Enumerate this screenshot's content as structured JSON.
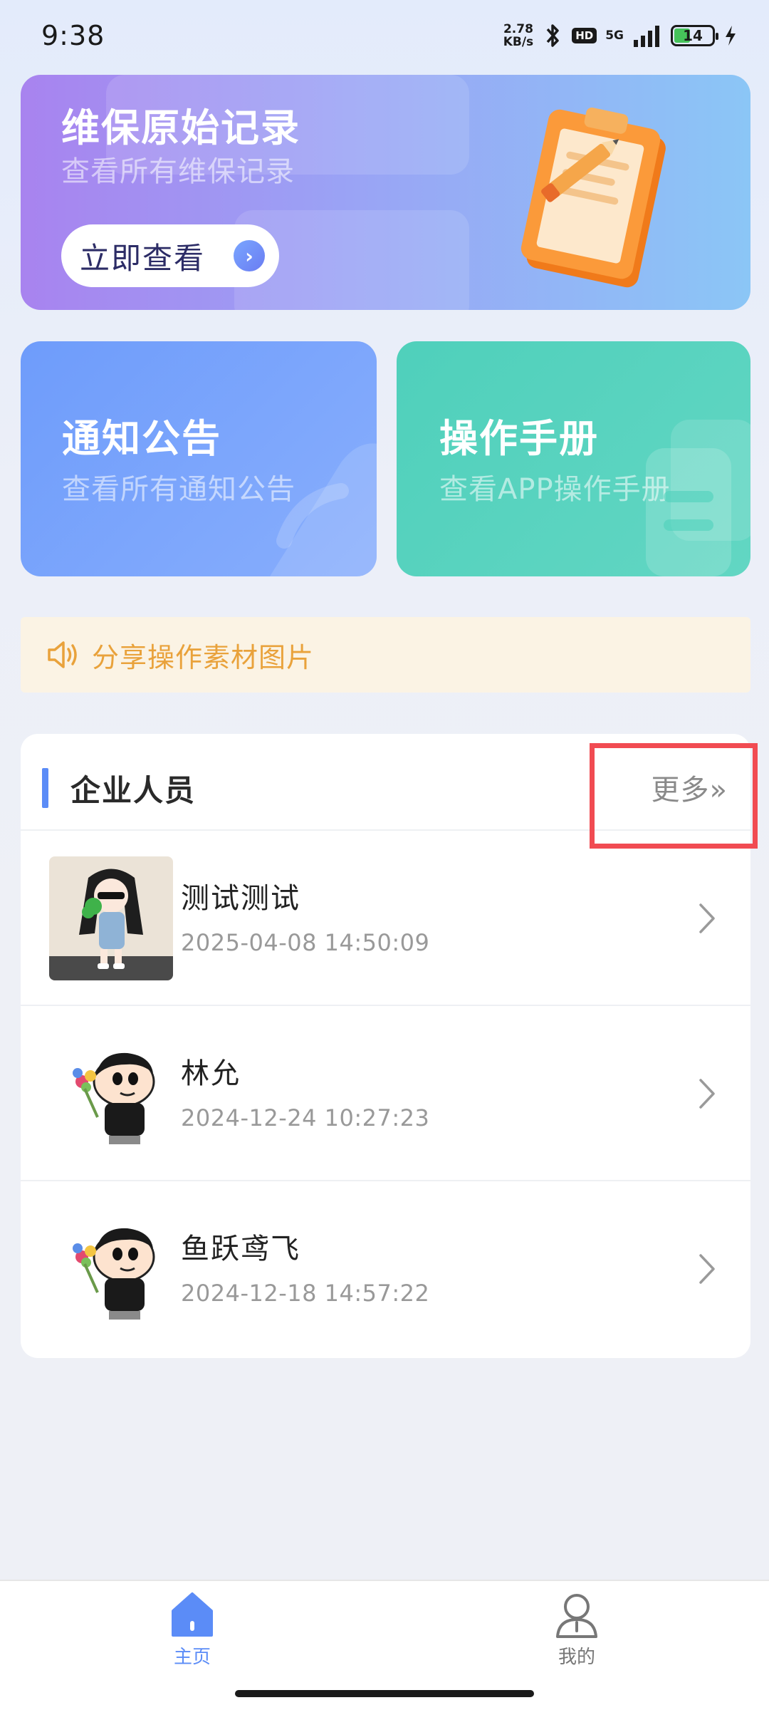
{
  "status_bar": {
    "time": "9:38",
    "net_speed_value": "2.78",
    "net_speed_unit": "KB/s",
    "hd_label": "HD",
    "signal_label": "5G",
    "battery_level": "14",
    "icons": [
      "bluetooth-icon",
      "hd-icon",
      "signal-icon",
      "battery-icon",
      "charging-icon"
    ]
  },
  "maintenance_card": {
    "title": "维保原始记录",
    "subtitle": "查看所有维保记录",
    "button_label": "立即查看",
    "icon": "clipboard-icon"
  },
  "notice_card": {
    "title": "通知公告",
    "subtitle": "查看所有通知公告",
    "icon": "megaphone-icon"
  },
  "manual_card": {
    "title": "操作手册",
    "subtitle": "查看APP操作手册",
    "icon": "document-icon"
  },
  "share_banner": {
    "text": "分享操作素材图片",
    "icon": "speaker-icon",
    "color": "#e9a23b"
  },
  "staff_section": {
    "title": "企业人员",
    "more_label": "更多»",
    "members": [
      {
        "name": "测试测试",
        "time": "2025-04-08 14:50:09",
        "avatar": "girl-avatar"
      },
      {
        "name": "林允",
        "time": "2024-12-24 10:27:23",
        "avatar": "cartoon-boy-avatar"
      },
      {
        "name": "鱼跃鸢飞",
        "time": "2024-12-18 14:57:22",
        "avatar": "cartoon-boy-avatar"
      }
    ]
  },
  "bottom_nav": {
    "items": [
      {
        "label": "主页",
        "icon": "home-icon",
        "active": true
      },
      {
        "label": "我的",
        "icon": "user-icon",
        "active": false
      }
    ],
    "active_color": "#5b8cf7",
    "inactive_color": "#777777"
  }
}
